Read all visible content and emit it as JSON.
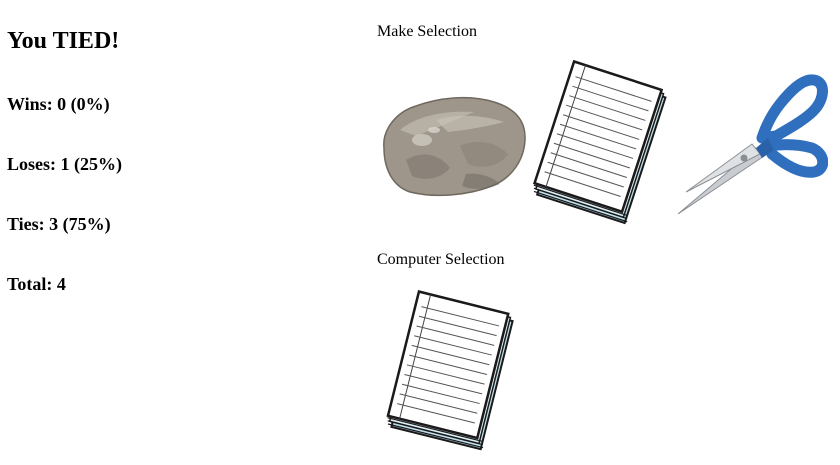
{
  "result": {
    "title": "You TIED!"
  },
  "stats": {
    "wins": "Wins: 0 (0%)",
    "loses": "Loses: 1 (25%)",
    "ties": "Ties: 3 (75%)",
    "total": "Total: 4"
  },
  "player": {
    "label": "Make Selection",
    "options": [
      {
        "name": "rock",
        "icon": "rock-icon"
      },
      {
        "name": "paper",
        "icon": "paper-stack-icon"
      },
      {
        "name": "scissors",
        "icon": "scissors-icon"
      }
    ]
  },
  "computer": {
    "label": "Computer Selection",
    "selection": "paper",
    "icon": "paper-stack-icon"
  },
  "colors": {
    "rock": "#9e968b",
    "paper_edge": "#8fc3d8",
    "scissors_handle": "#2f6fbe",
    "scissors_blade": "#c9ccd0"
  }
}
